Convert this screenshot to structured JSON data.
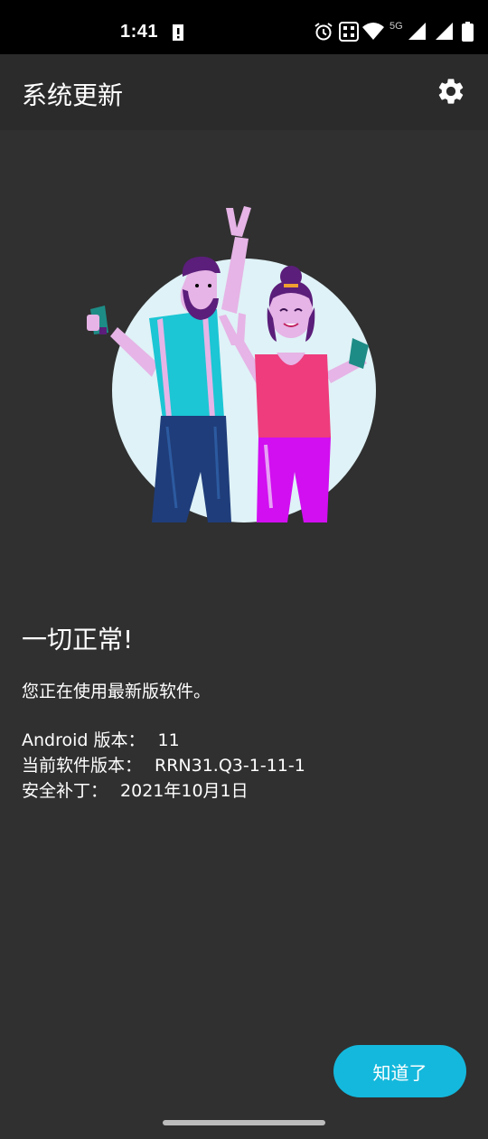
{
  "status_bar": {
    "time": "1:41",
    "network_label": "5G",
    "icons": [
      "alert-icon",
      "alarm-icon",
      "nfc-icon",
      "wifi-icon",
      "signal-icon",
      "signal-icon",
      "battery-icon"
    ]
  },
  "app_bar": {
    "title": "系统更新",
    "settings_icon": "gear-icon"
  },
  "main": {
    "headline": "一切正常!",
    "subtext": "您正在使用最新版软件。",
    "info": [
      {
        "label": "Android 版本：",
        "value": "11"
      },
      {
        "label": "当前软件版本：",
        "value": "RRN31.Q3-1-11-1"
      },
      {
        "label": "安全补丁：",
        "value": "2021年10月1日"
      }
    ]
  },
  "actions": {
    "ok_label": "知道了"
  },
  "colors": {
    "background": "#303030",
    "app_bar": "#2b2b2b",
    "accent": "#14b8dc"
  }
}
